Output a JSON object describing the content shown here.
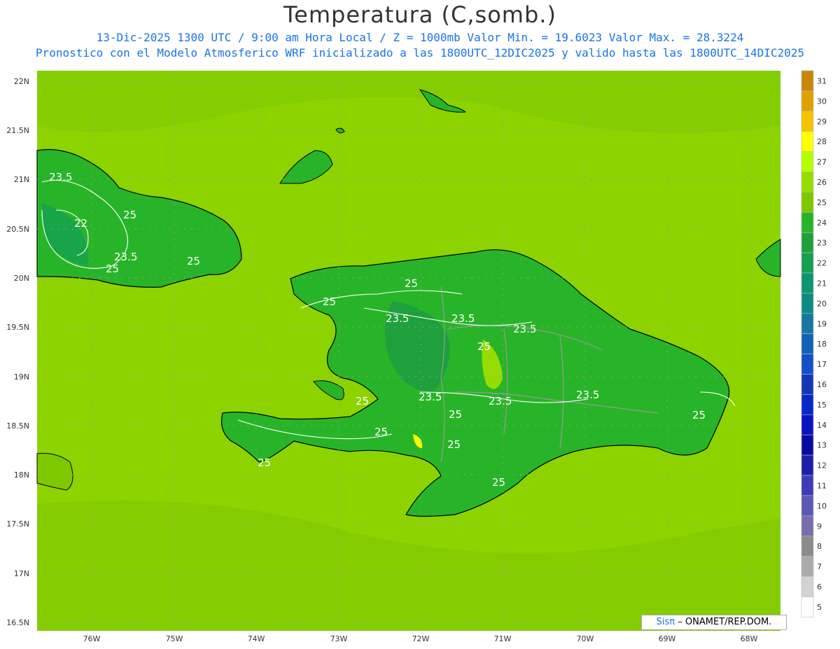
{
  "header": {
    "title": "Temperatura (C,somb.)",
    "subtitle1": "13-Dic-2025  1300 UTC / 9:00 am Hora Local / Z = 1000mb   Valor Min. = 19.6023  Valor Max. = 28.3224",
    "subtitle2": "Pronostico con el Modelo Atmosferico WRF inicializado a las 1800UTC_12DIC2025 y valido hasta las  1800UTC_14DIC2025"
  },
  "axes": {
    "lat_ticks": [
      "22N",
      "21.5N",
      "21N",
      "20.5N",
      "20N",
      "19.5N",
      "19N",
      "18.5N",
      "18N",
      "17.5N",
      "17N",
      "16.5N"
    ],
    "lon_ticks": [
      "76W",
      "75W",
      "74W",
      "73W",
      "72W",
      "71W",
      "70W",
      "69W",
      "68W"
    ]
  },
  "colorbar": {
    "labels": [
      "31",
      "30",
      "29",
      "28",
      "27",
      "26",
      "25",
      "24",
      "23",
      "22",
      "21",
      "20",
      "19",
      "18",
      "17",
      "16",
      "15",
      "14",
      "13",
      "12",
      "11",
      "10",
      "9",
      "8",
      "7",
      "6",
      "5"
    ],
    "colors": [
      "#c8860a",
      "#e0a000",
      "#f5c400",
      "#ffff00",
      "#b4ff00",
      "#96dc00",
      "#7ec800",
      "#28b428",
      "#1ea03c",
      "#14a050",
      "#0a966e",
      "#0a8c82",
      "#1478a0",
      "#1464b4",
      "#1450c8",
      "#1438b4",
      "#0a28c8",
      "#0a14be",
      "#0a0aa0",
      "#1e1eaa",
      "#3c3cb4",
      "#5a5ab4",
      "#786eaa",
      "#8c8c8c",
      "#aaaaaa",
      "#d2d2d2",
      "#ffffff"
    ]
  },
  "contours": {
    "labels": [
      "23.5",
      "22",
      "25",
      "23.5",
      "25",
      "25",
      "25",
      "25",
      "23.5",
      "23.5",
      "23.5",
      "25",
      "23.5",
      "23.5",
      "23.5",
      "25",
      "25",
      "25",
      "25",
      "25",
      "25",
      "25"
    ]
  },
  "credit": {
    "logo_text": "Sisπ",
    "text": "– ONAMET/REP.DOM."
  },
  "colors": {
    "ocean": "#8cd300",
    "land": "#28b428",
    "land_high": "#96dc00",
    "sea_lighter": "#7ec800"
  }
}
